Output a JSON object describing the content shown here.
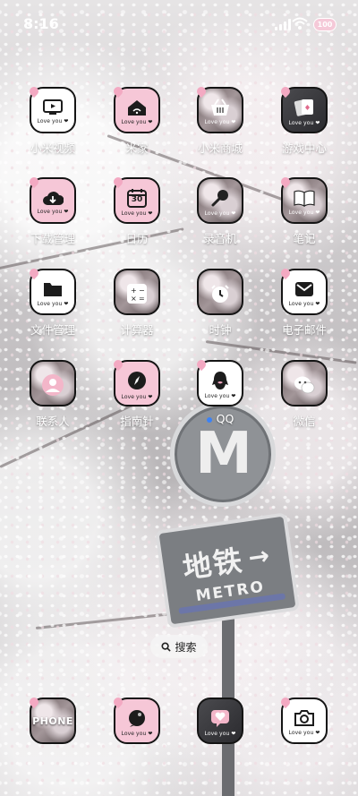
{
  "status_bar": {
    "time": "8:16",
    "battery_level": "100"
  },
  "apps": [
    {
      "label": "小米视频",
      "icon": "tv-icon",
      "love": "Love you ❤"
    },
    {
      "label": "米家",
      "icon": "home-wifi-icon",
      "love": "Love you ❤"
    },
    {
      "label": "小米商城",
      "icon": "shopping-basket-icon",
      "love": "Love you ❤"
    },
    {
      "label": "游戏中心",
      "icon": "game-cards-icon",
      "love": "Love you ❤"
    },
    {
      "label": "下载管理",
      "icon": "cloud-download-icon",
      "love": "Love you ❤"
    },
    {
      "label": "日历",
      "icon": "calendar-icon",
      "love": "Love you ❤",
      "day": "30"
    },
    {
      "label": "录音机",
      "icon": "microphone-icon",
      "love": "Love you ❤"
    },
    {
      "label": "笔记",
      "icon": "open-book-icon",
      "love": "Love you ❤"
    },
    {
      "label": "文件管理",
      "icon": "folder-icon",
      "love": "Love you ❤"
    },
    {
      "label": "计算器",
      "icon": "calculator-icon",
      "love": "Love you ❤"
    },
    {
      "label": "时钟",
      "icon": "alarm-clock-icon",
      "love": "Love you ❤"
    },
    {
      "label": "电子邮件",
      "icon": "mail-icon",
      "love": "Love you ❤"
    },
    {
      "label": "联系人",
      "icon": "contact-person-icon",
      "love": "Love you ❤"
    },
    {
      "label": "指南针",
      "icon": "compass-icon",
      "love": "Love you ❤"
    },
    {
      "label": "QQ",
      "icon": "qq-penguin-icon",
      "love": "Love you ❤",
      "notification": true
    },
    {
      "label": "微信",
      "icon": "wechat-icon",
      "love": "Love you ❤"
    }
  ],
  "search": {
    "label": "搜索"
  },
  "dock": [
    {
      "icon": "phone-icon",
      "text": "PHONE"
    },
    {
      "icon": "message-bubble-icon",
      "love": "Love you ❤"
    },
    {
      "icon": "heart-message-icon",
      "love": "Love you ❤"
    },
    {
      "icon": "camera-icon",
      "love": "Love you ❤"
    }
  ],
  "wallpaper": {
    "sign_cn": "地铁",
    "sign_en": "METRO",
    "metro_logo": "M"
  },
  "colors": {
    "icon_pink": "#f6c7d7",
    "heart_accent": "#f3a9c2",
    "label_text": "#ffffff",
    "notification_dot": "#3b82f6"
  }
}
